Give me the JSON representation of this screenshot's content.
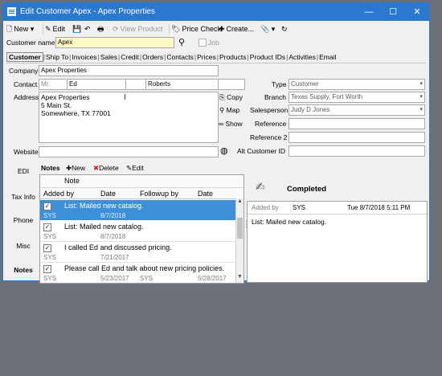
{
  "window": {
    "title": "Edit Customer Apex - Apex Properties",
    "minimize": "—",
    "maximize": "☐",
    "close": "✕"
  },
  "toolbar": {
    "new_label": "New",
    "edit_label": "Edit",
    "view_product_label": "View Product",
    "price_check_label": "Price Check",
    "create_label": "Create..."
  },
  "customer_name": {
    "label": "Customer name",
    "value": "Apex",
    "job_label": "Job"
  },
  "tabs": [
    "Customer",
    "Ship To",
    "Invoices",
    "Sales",
    "Credit",
    "Orders",
    "Contacts",
    "Prices",
    "Products",
    "Product IDs",
    "Activities",
    "Email"
  ],
  "form": {
    "company_label": "Company",
    "company_value": "Apex Properties",
    "contact_label": "Contact",
    "contact_prefix": "Mr.",
    "contact_first": "Ed",
    "contact_last": "Roberts",
    "address_label": "Address",
    "address_lines": [
      "Apex Properties",
      "5 Main St.",
      "Somewhere, TX 77001"
    ],
    "copy_label": "Copy",
    "map_label": "Map",
    "show_label": "Show",
    "website_label": "Website",
    "type_label": "Type",
    "type_value": "Customer",
    "branch_label": "Branch",
    "branch_value": "Texas Supply, Fort Worth",
    "salesperson_label": "Salesperson",
    "salesperson_value": "Judy D Jones",
    "reference_label": "Reference",
    "reference2_label": "Reference 2",
    "alt_customer_label": "Alt Customer ID"
  },
  "side_tabs": [
    "EDI",
    "Tax Info",
    "Phone",
    "Misc",
    "Notes"
  ],
  "notes": {
    "title": "Notes",
    "new_label": "New",
    "delete_label": "Delete",
    "edit_label": "Edit",
    "headers": {
      "note": "Note",
      "added_by": "Added by",
      "date": "Date",
      "followup_by": "Followup by",
      "date2": "Date"
    },
    "rows": [
      {
        "text": "List: Mailed new catalog.",
        "by": "SYS",
        "date": "8/7/2018",
        "followup": "",
        "fdate": ""
      },
      {
        "text": "List: Mailed new catalog.",
        "by": "SYS",
        "date": "8/7/2018",
        "followup": "",
        "fdate": ""
      },
      {
        "text": "I called Ed and discussed pricing.",
        "by": "SYS",
        "date": "7/21/2017",
        "followup": "",
        "fdate": ""
      },
      {
        "text": "Please call Ed and talk about new pricing policies.",
        "by": "SYS",
        "date": "5/23/2017",
        "followup": "SYS",
        "fdate": "5/28/2017"
      }
    ]
  },
  "detail": {
    "status": "Completed",
    "added_by_label": "Added by",
    "added_by_value": "SYS",
    "datetime": "Tue 8/7/2018 5:11 PM",
    "text": "List:  Mailed new catalog."
  }
}
